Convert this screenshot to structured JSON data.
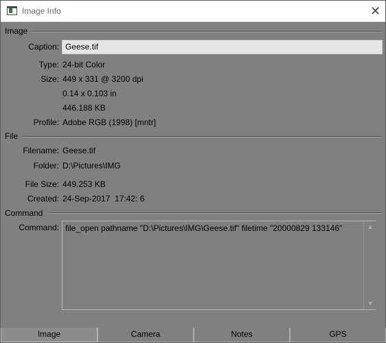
{
  "window": {
    "title": "Image Info",
    "close_glyph": "✕"
  },
  "image_section": {
    "header": "Image",
    "caption_label": "Caption:",
    "caption_value": "Geese.tif",
    "type_label": "Type:",
    "type_value": "24-bit Color",
    "size_label": "Size:",
    "size_value_1": "449 x 331 @ 3200 dpi",
    "size_value_2": "0.14 x 0.103 in",
    "size_value_3": "446.188 KB",
    "profile_label": "Profile:",
    "profile_value": "Adobe RGB (1998) [mntr]"
  },
  "file_section": {
    "header": "File",
    "filename_label": "Filename:",
    "filename_value": "Geese.tif",
    "folder_label": "Folder:",
    "folder_value": "D:\\Pictures\\IMG",
    "filesize_label": "File Size:",
    "filesize_value": "449.253 KB",
    "created_label": "Created:",
    "created_value": "24-Sep-2017  17:42: 6"
  },
  "command_section": {
    "header": "Command",
    "command_label": "Command:",
    "command_text": "file_open pathname \"D:\\Pictures\\IMG\\Geese.tif\" filetime \"20000829 133146\""
  },
  "tabs": [
    {
      "label": "Image",
      "active": true
    },
    {
      "label": "Camera",
      "active": false
    },
    {
      "label": "Notes",
      "active": false
    },
    {
      "label": "GPS",
      "active": false
    }
  ],
  "colors": {
    "background": "#808080",
    "caption_field": "#e6e6e6",
    "titlebar": "#ffffff"
  },
  "icons": {
    "app": "image-info-app-icon",
    "close": "close-icon",
    "scroll_up": "chevron-up-icon",
    "scroll_down": "chevron-down-icon"
  }
}
